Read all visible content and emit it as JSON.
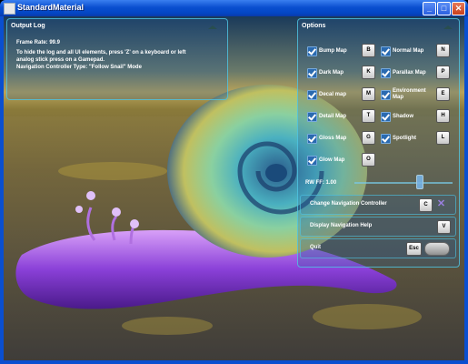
{
  "window": {
    "title": "StandardMaterial",
    "minimize": "_",
    "maximize": "□",
    "close": "✕"
  },
  "output_log": {
    "title": "Output Log",
    "frame_rate": "Frame Rate: 99.9",
    "hint_line1": "To hide the log and all UI elements, press 'Z' on a keyboard or left",
    "hint_line2": "analog stick press on a Gamepad.",
    "nav_type": "Navigation Controller Type: \"Follow Snail\" Mode"
  },
  "options": {
    "title": "Options",
    "items": [
      {
        "label": "Bump Map",
        "key": "B"
      },
      {
        "label": "Normal Map",
        "key": "N"
      },
      {
        "label": "Dark Map",
        "key": "K"
      },
      {
        "label": "Parallax Map",
        "key": "P"
      },
      {
        "label": "Decal map",
        "key": "M"
      },
      {
        "label": "Environment Map",
        "key": "E"
      },
      {
        "label": "Detail Map",
        "key": "T"
      },
      {
        "label": "Shadow",
        "key": "H"
      },
      {
        "label": "Gloss Map",
        "key": "G"
      },
      {
        "label": "Spotlight",
        "key": "L"
      },
      {
        "label": "Glow Map",
        "key": "O"
      }
    ],
    "rw_ff": "RW FF: 1.00",
    "change_nav": {
      "label": "Change Navigation Controller",
      "key": "C"
    },
    "display_nav_help": {
      "label": "Display Navigation Help",
      "key": "V"
    },
    "quit": {
      "label": "Quit",
      "key": "Esc"
    }
  }
}
